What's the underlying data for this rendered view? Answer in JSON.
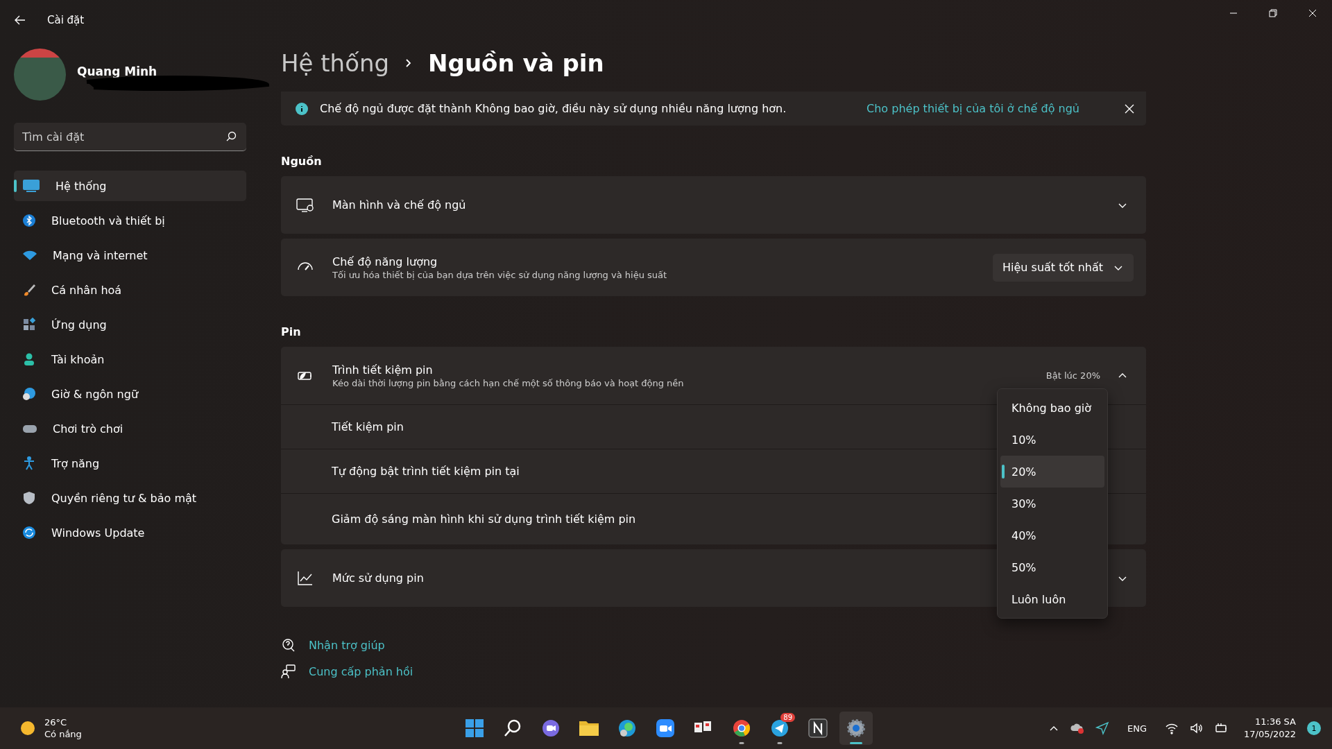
{
  "window": {
    "title": "Cài đặt"
  },
  "profile": {
    "name": "Quang Minh"
  },
  "search": {
    "placeholder": "Tìm cài đặt"
  },
  "sidebar": {
    "items": [
      {
        "label": "Hệ thống",
        "selected": true
      },
      {
        "label": "Bluetooth và thiết bị",
        "selected": false
      },
      {
        "label": "Mạng và internet",
        "selected": false
      },
      {
        "label": "Cá nhân hoá",
        "selected": false
      },
      {
        "label": "Ứng dụng",
        "selected": false
      },
      {
        "label": "Tài khoản",
        "selected": false
      },
      {
        "label": "Giờ & ngôn ngữ",
        "selected": false
      },
      {
        "label": "Chơi trò chơi",
        "selected": false
      },
      {
        "label": "Trợ năng",
        "selected": false
      },
      {
        "label": "Quyền riêng tư & bảo mật",
        "selected": false
      },
      {
        "label": "Windows Update",
        "selected": false
      }
    ]
  },
  "breadcrumb": {
    "parent": "Hệ thống",
    "current": "Nguồn và pin"
  },
  "banner": {
    "message": "Chế độ ngủ được đặt thành Không bao giờ, điều này sử dụng nhiều năng lượng hơn.",
    "link": "Cho phép thiết bị của tôi ở chế độ ngủ"
  },
  "sections": [
    {
      "title": "Nguồn",
      "cards": [
        {
          "kind": "expander",
          "title": "Màn hình và chế độ ngủ",
          "expanded": false
        },
        {
          "kind": "select",
          "title": "Chế độ năng lượng",
          "subtitle": "Tối ưu hóa thiết bị của bạn dựa trên việc sử dụng năng lượng và hiệu suất",
          "value": "Hiệu suất tốt nhất"
        }
      ]
    },
    {
      "title": "Pin",
      "cards": [
        {
          "kind": "expander",
          "title": "Trình tiết kiệm pin",
          "subtitle": "Kéo dài thời lượng pin bằng cách hạn chế một số thông báo và hoạt động nền",
          "status": "Bật lúc 20%",
          "expanded": true,
          "children": [
            {
              "label": "Tiết kiệm pin"
            },
            {
              "label": "Tự động bật trình tiết kiệm pin tại"
            },
            {
              "label": "Giảm độ sáng màn hình khi sử dụng trình tiết kiệm pin"
            }
          ]
        },
        {
          "kind": "expander",
          "title": "Mức sử dụng pin",
          "expanded": false
        }
      ]
    }
  ],
  "dropdown": {
    "options": [
      {
        "label": "Không bao giờ",
        "selected": false
      },
      {
        "label": "10%",
        "selected": false
      },
      {
        "label": "20%",
        "selected": true
      },
      {
        "label": "30%",
        "selected": false
      },
      {
        "label": "40%",
        "selected": false
      },
      {
        "label": "50%",
        "selected": false
      },
      {
        "label": "Luôn luôn",
        "selected": false
      }
    ]
  },
  "help_links": [
    "Nhận trợ giúp",
    "Cung cấp phản hồi"
  ],
  "taskbar": {
    "weather": {
      "temperature": "26°C",
      "condition": "Có nắng"
    },
    "apps": [
      {
        "running": false,
        "active": false
      },
      {
        "running": false,
        "active": false
      },
      {
        "running": false,
        "active": false
      },
      {
        "running": false,
        "active": false
      },
      {
        "running": false,
        "active": false
      },
      {
        "running": false,
        "active": false
      },
      {
        "running": false,
        "active": false
      },
      {
        "running": true,
        "active": false
      },
      {
        "running": true,
        "active": false,
        "badge": "89"
      },
      {
        "running": false,
        "active": false
      },
      {
        "running": true,
        "active": true
      }
    ],
    "language": "ENG",
    "time": "11:36 SA",
    "date": "17/05/2022",
    "notifications": "1"
  }
}
